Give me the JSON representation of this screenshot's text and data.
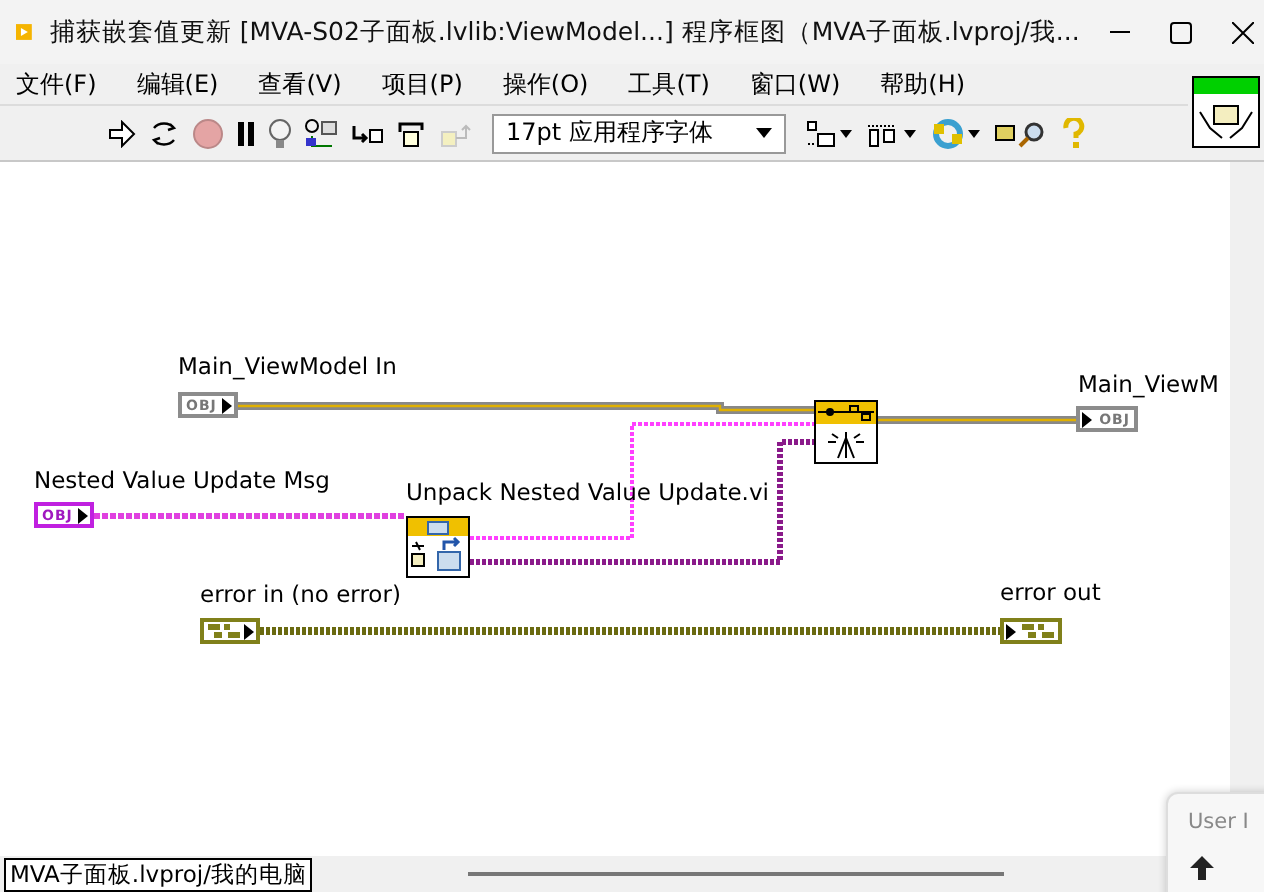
{
  "window": {
    "title": "捕获嵌套值更新 [MVA-S02子面板.lvlib:ViewModel...] 程序框图（MVA子面板.lvproj/我..."
  },
  "menu": [
    "文件(F)",
    "编辑(E)",
    "查看(V)",
    "项目(P)",
    "操作(O)",
    "工具(T)",
    "窗口(W)",
    "帮助(H)"
  ],
  "toolbar": {
    "font": "17pt 应用程序字体"
  },
  "diagram": {
    "terminals": [
      {
        "kind": "object",
        "label": "Main_ViewModel In",
        "tag": "OBJ",
        "indicator": false
      },
      {
        "kind": "message",
        "label": "Nested Value Update Msg",
        "tag": "OBJ",
        "indicator": false
      },
      {
        "kind": "error",
        "label": "error in (no error)",
        "indicator": false
      },
      {
        "kind": "object",
        "label": "Main_ViewM",
        "tag": "OBJ",
        "indicator": true
      },
      {
        "kind": "error",
        "label": "error out",
        "indicator": true
      }
    ],
    "subvi": {
      "label": "Unpack Nested Value Update.vi"
    }
  },
  "status_bar": {
    "path": "MVA子面板.lvproj/我的电脑"
  },
  "popup": {
    "text": "User I"
  }
}
